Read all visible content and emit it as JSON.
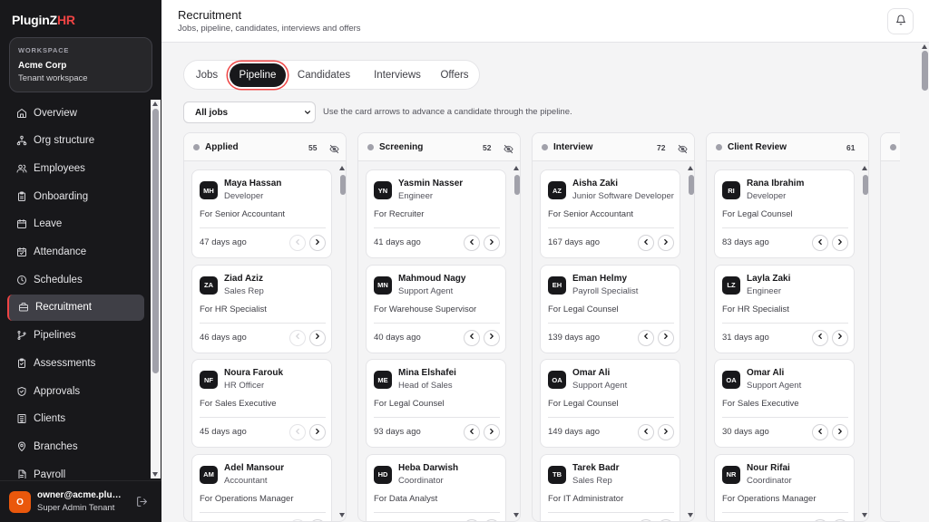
{
  "brand": {
    "main": "PluginZ",
    "accent": "HR",
    "accent_color": "#ef4444"
  },
  "workspace": {
    "label": "WORKSPACE",
    "name": "Acme Corp",
    "sub": "Tenant workspace"
  },
  "nav": [
    {
      "label": "Overview",
      "icon": "home-icon"
    },
    {
      "label": "Org structure",
      "icon": "org-structure-icon"
    },
    {
      "label": "Employees",
      "icon": "users-icon"
    },
    {
      "label": "Onboarding",
      "icon": "clipboard-icon"
    },
    {
      "label": "Leave",
      "icon": "calendar-icon"
    },
    {
      "label": "Attendance",
      "icon": "calendar-check-icon"
    },
    {
      "label": "Schedules",
      "icon": "clock-icon"
    },
    {
      "label": "Recruitment",
      "icon": "briefcase-icon",
      "active": true
    },
    {
      "label": "Pipelines",
      "icon": "git-branch-icon"
    },
    {
      "label": "Assessments",
      "icon": "clipboard-check-icon"
    },
    {
      "label": "Approvals",
      "icon": "shield-check-icon"
    },
    {
      "label": "Clients",
      "icon": "building-icon"
    },
    {
      "label": "Branches",
      "icon": "map-pin-icon"
    },
    {
      "label": "Payroll",
      "icon": "file-icon"
    }
  ],
  "user": {
    "initial": "O",
    "email": "owner@acme.pluginz.hr",
    "role": "Super Admin Tenant"
  },
  "header": {
    "title": "Recruitment",
    "subtitle": "Jobs, pipeline, candidates, interviews and offers"
  },
  "tabs": [
    {
      "label": "Jobs"
    },
    {
      "label": "Pipeline",
      "active": true
    },
    {
      "label": "Candidates"
    },
    {
      "label": "Interviews"
    },
    {
      "label": "Offers"
    }
  ],
  "filter": {
    "selected": "All jobs",
    "hint": "Use the card arrows to advance a candidate through the pipeline."
  },
  "columns": [
    {
      "title": "Applied",
      "count": "55",
      "cards": [
        {
          "initials": "MH",
          "name": "Maya Hassan",
          "role": "Developer",
          "for": "For Senior Accountant",
          "days": "47 days ago"
        },
        {
          "initials": "ZA",
          "name": "Ziad Aziz",
          "role": "Sales Rep",
          "for": "For HR Specialist",
          "days": "46 days ago"
        },
        {
          "initials": "NF",
          "name": "Noura Farouk",
          "role": "HR Officer",
          "for": "For Sales Executive",
          "days": "45 days ago"
        },
        {
          "initials": "AM",
          "name": "Adel Mansour",
          "role": "Accountant",
          "for": "For Operations Manager",
          "days": ""
        }
      ]
    },
    {
      "title": "Screening",
      "count": "52",
      "cards": [
        {
          "initials": "YN",
          "name": "Yasmin Nasser",
          "role": "Engineer",
          "for": "For Recruiter",
          "days": "41 days ago"
        },
        {
          "initials": "MN",
          "name": "Mahmoud Nagy",
          "role": "Support Agent",
          "for": "For Warehouse Supervisor",
          "days": "40 days ago"
        },
        {
          "initials": "ME",
          "name": "Mina Elshafei",
          "role": "Head of Sales",
          "for": "For Legal Counsel",
          "days": "93 days ago"
        },
        {
          "initials": "HD",
          "name": "Heba Darwish",
          "role": "Coordinator",
          "for": "For Data Analyst",
          "days": ""
        }
      ]
    },
    {
      "title": "Interview",
      "count": "72",
      "cards": [
        {
          "initials": "AZ",
          "name": "Aisha Zaki",
          "role": "Junior Software Developer",
          "for": "For Senior Accountant",
          "days": "167 days ago"
        },
        {
          "initials": "EH",
          "name": "Eman Helmy",
          "role": "Payroll Specialist",
          "for": "For Legal Counsel",
          "days": "139 days ago"
        },
        {
          "initials": "OA",
          "name": "Omar Ali",
          "role": "Support Agent",
          "for": "For Legal Counsel",
          "days": "149 days ago"
        },
        {
          "initials": "TB",
          "name": "Tarek Badr",
          "role": "Sales Rep",
          "for": "For IT Administrator",
          "days": ""
        }
      ]
    },
    {
      "title": "Client Review",
      "count": "61",
      "cards": [
        {
          "initials": "RI",
          "name": "Rana Ibrahim",
          "role": "Developer",
          "for": "For Legal Counsel",
          "days": "83 days ago"
        },
        {
          "initials": "LZ",
          "name": "Layla Zaki",
          "role": "Engineer",
          "for": "For HR Specialist",
          "days": "31 days ago"
        },
        {
          "initials": "OA",
          "name": "Omar Ali",
          "role": "Support Agent",
          "for": "For Sales Executive",
          "days": "30 days ago"
        },
        {
          "initials": "NR",
          "name": "Nour Rifai",
          "role": "Coordinator",
          "for": "For Operations Manager",
          "days": ""
        }
      ]
    }
  ]
}
